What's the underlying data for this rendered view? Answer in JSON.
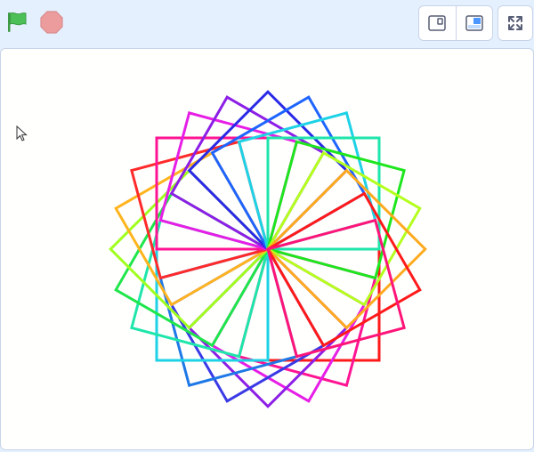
{
  "toolbar": {
    "green_flag": {
      "icon": "green-flag-icon",
      "color": "#4cbf56"
    },
    "stop": {
      "icon": "stop-sign-icon",
      "color": "#ec9c9c"
    },
    "layout_modes": [
      {
        "icon": "small-stage-icon",
        "selected": false
      },
      {
        "icon": "normal-stage-icon",
        "selected": true
      }
    ],
    "fullscreen": {
      "icon": "fullscreen-icon"
    }
  },
  "stage": {
    "background": "#fffffe",
    "drawing": {
      "shape": "square",
      "count": 24,
      "rotation_step_deg": 15,
      "colors": [
        "#ff1a1a",
        "#ff1493",
        "#e61ee6",
        "#8c1ee6",
        "#3a3ae6",
        "#1e78e6",
        "#1ed2e6",
        "#1ee6aa",
        "#1ee64b",
        "#a0ff1e",
        "#ffb41e",
        "#ff2a2a",
        "#ff1493",
        "#e61ee6",
        "#8c1ee6",
        "#2a2ae6",
        "#1e64ff",
        "#1ed2e6",
        "#1ee6aa",
        "#1ee61e",
        "#b4ff1e",
        "#ffaa1e",
        "#ff1a1a",
        "#ff1478"
      ]
    }
  }
}
